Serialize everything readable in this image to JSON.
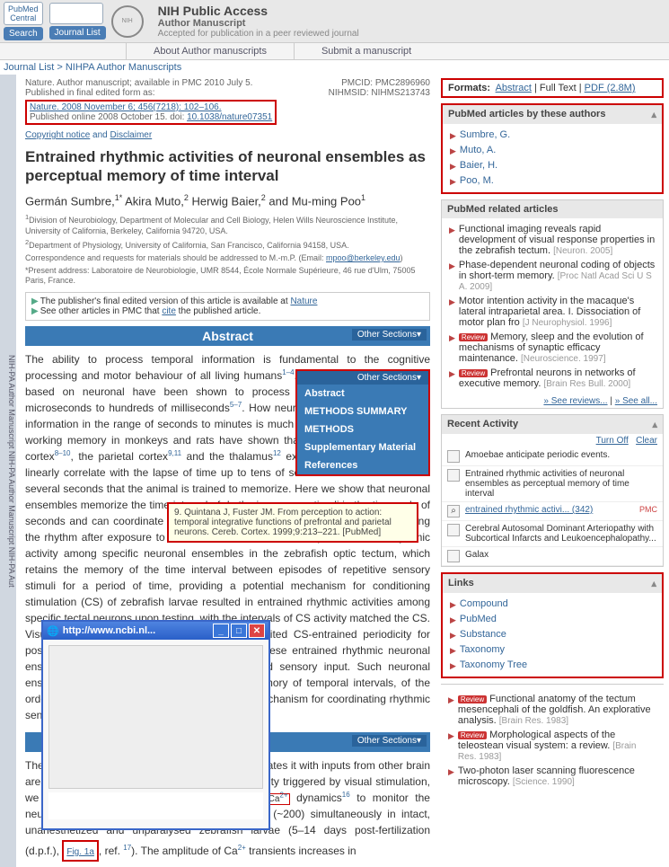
{
  "header": {
    "logo1_line1": "PubMed",
    "logo1_line2": "Central",
    "btn_search": "Search",
    "btn_journal": "Journal List",
    "nih_title": "NIH Public Access",
    "nih_sub": "Author Manuscript",
    "nih_sub2": "Accepted for publication in a peer reviewed journal",
    "nav_about": "About Author manuscripts",
    "nav_submit": "Submit a manuscript"
  },
  "breadcrumb": {
    "link1": "Journal List",
    "link2": "NIHPA Author Manuscripts"
  },
  "side_label": "NIH-PA Author Manuscript    NIH-PA Author Manuscript    NIH-PA Aut",
  "pub": {
    "line1": "Nature. Author manuscript; available in PMC 2010 July 5.",
    "line2": "Published in final edited form as:",
    "citation": "Nature. 2008 November 6; 456(7218): 102–106.",
    "doi_prefix": "Published online 2008 October 15. doi: ",
    "doi": "10.1038/nature07351",
    "pmcid": "PMCID: PMC2896960",
    "nihmsid": "NIHMSID: NIHMS213743",
    "copyright": "Copyright notice",
    "disclaimer": "Disclaimer",
    "and": " and "
  },
  "title": "Entrained rhythmic activities of neuronal ensembles as perceptual memory of time interval",
  "authors_html": "Germán Sumbre,<sup>1*</sup> Akira Muto,<sup>2</sup> Herwig Baier,<sup>2</sup> and Mu-ming Poo<sup>1</sup>",
  "affils": [
    "<sup>1</sup>Division of Neurobiology, Department of Molecular and Cell Biology, Helen Wills Neuroscience Institute, University of California, Berkeley, California 94720, USA.",
    "<sup>2</sup>Department of Physiology, University of California, San Francisco, California 94158, USA.",
    "Correspondence and requests for materials should be addressed to M.-m.P. (Email: <a href='#'>mpoo@berkeley.edu</a>)",
    "*Present address: Laboratoire de Neurobiologie, UMR 8544, École Normale Supérieure, 46 rue d'Ulm, 75005 Paris, France."
  ],
  "pub_note": {
    "line1_pre": "The publisher's final edited version of this article is available at ",
    "line1_link": "Nature",
    "line2_pre": "See other articles in PMC that ",
    "line2_link": "cite",
    "line2_post": " the published article."
  },
  "section": {
    "abstract": "Abstract",
    "other": "Other Sections▾"
  },
  "abstract_text": "The ability to process temporal information is fundamental to the cognitive processing and motor behaviour of all living humans<sup>1–4</sup>. Neural circuit mechanisms based on neuronal have been shown to process temporal information over microseconds to hundreds of milliseconds<sup>5–7</sup>. How neural circuits process temporal information in the range of seconds to minutes is much less understood. Studies of working memory in monkeys and rats have shown that neurons in the prefrontal cortex<sup>8–10</sup>, the parietal cortex<sup>9,11</sup> and the thalamus<sup>12</sup> exhibit ramping activities that linearly correlate with the lapse of time up to tens of seconds before the arrival of several seconds that the animal is trained to memorize. Here we show that neuronal ensembles memorize the time interval of rhythmic sensory stimuli in the timescale of seconds and can coordinate motor behaviour accordingly, for example, by keeping the rhythm after exposure to the beat of music. Here we report a form of rhythmic activity among specific neuronal ensembles in the zebrafish optic tectum, which retains the memory of the time interval between episodes of repetitive sensory stimuli for a period of time, providing a potential mechanism for conditioning stimulation (CS) of zebrafish larvae resulted in entrained rhythmic activities among specific tectal neurons upon testing, with the intervals of CS activity matched the CS. Visuomotor behaviours of zebrafish larvae exhibited CS-entrained periodicity for post-CS repetitions at the entrained intervals. These entrained rhythmic neuronal ensemble activities in the absence of continued sensory input. Such neuronal ensembles may act as an intermediate-term memory of temporal intervals, of the order of seconds, and serve as a time-keeping mechanism for coordinating rhythmic sensory experience.",
  "body2_text": "The optic tectum receives sensory input and integrates it with inputs from other brain areas<sup>13,14</sup>. To monitor the ensemble neuronal activity triggered by visual stimulation, we performed Ca<sup>2+</sup> fluorescence imaging<sup>15</sup> of <span class='ca-box'>Ca<sup>2+</sup></span> dynamics<sup>16</sup> to monitor the neuronal activities of a large population of cells (~200) simultaneously in intact, unanesthetized and unparalysed zebrafish larvae (5–14 days post-fertilization (d.p.f.), <span class='red-box'><a href='#'>Fig. 1a</a></span>, ref. <sup>17</sup>). The amplitude of Ca<sup>2+</sup> transients increases in",
  "dropdown": {
    "head": "Other Sections▾",
    "items": [
      "Abstract",
      "METHODS SUMMARY",
      "METHODS",
      "Supplementary Material",
      "References"
    ]
  },
  "tooltip": "9. Quintana J, Fuster JM. From perception to action: temporal integrative functions of prefrontal and parietal neurons. Cereb. Cortex. 1999;9:213–221. [PubMed]",
  "popup": {
    "url": "http://www.ncbi.nl..."
  },
  "right": {
    "formats_label": "Formats:",
    "formats": [
      "Abstract",
      "Full Text",
      "PDF (2.8M)"
    ],
    "authors_head": "PubMed articles by these authors",
    "authors": [
      "Sumbre, G.",
      "Muto, A.",
      "Baier, H.",
      "Poo, M."
    ],
    "related_head": "PubMed related articles",
    "related": [
      {
        "text": "Functional imaging reveals rapid development of visual response properties in the zebrafish tectum.",
        "src": "[Neuron. 2005]",
        "review": false
      },
      {
        "text": "Phase-dependent neuronal coding of objects in short-term memory.",
        "src": "[Proc Natl Acad Sci U S A. 2009]",
        "review": false
      },
      {
        "text": "Motor intention activity in the macaque's lateral intraparietal area. I. Dissociation of motor plan fro",
        "src": "[J Neurophysiol. 1996]",
        "review": false
      },
      {
        "text": "Memory, sleep and the evolution of mechanisms of synaptic efficacy maintenance.",
        "src": "[Neuroscience. 1997]",
        "review": true
      },
      {
        "text": "Prefrontal neurons in networks of executive memory.",
        "src": "[Brain Res Bull. 2000]",
        "review": true
      }
    ],
    "see_reviews": "» See reviews...",
    "see_all": "» See all...",
    "recent_head": "Recent Activity",
    "turn_off": "Turn Off",
    "clear": "Clear",
    "activity": [
      {
        "text": "Amoebae anticipate periodic events.",
        "link": false
      },
      {
        "text": "Entrained rhythmic activities of neuronal ensembles as perceptual memory of time interval",
        "link": false
      },
      {
        "text": "entrained rhythmic activi... (342)",
        "link": true,
        "tag": "PMC",
        "search": true
      },
      {
        "text": "Cerebral Autosomal Dominant Arteriopathy with Subcortical Infarcts and Leukoencephalopathy...",
        "link": false
      },
      {
        "text": "Galax",
        "link": false
      }
    ],
    "links_head": "Links",
    "links": [
      "Compound",
      "PubMed",
      "Substance",
      "Taxonomy",
      "Taxonomy Tree"
    ],
    "bottom": [
      {
        "text": "Functional anatomy of the tectum mesencephali of the goldfish. An explorative analysis.",
        "src": "[Brain Res. 1983]",
        "review": true
      },
      {
        "text": "Morphological aspects of the teleostean visual system: a review.",
        "src": "[Brain Res. 1983]",
        "review": true
      },
      {
        "text": "Two-photon laser scanning fluorescence microscopy.",
        "src": "[Science. 1990]",
        "review": false
      }
    ]
  }
}
